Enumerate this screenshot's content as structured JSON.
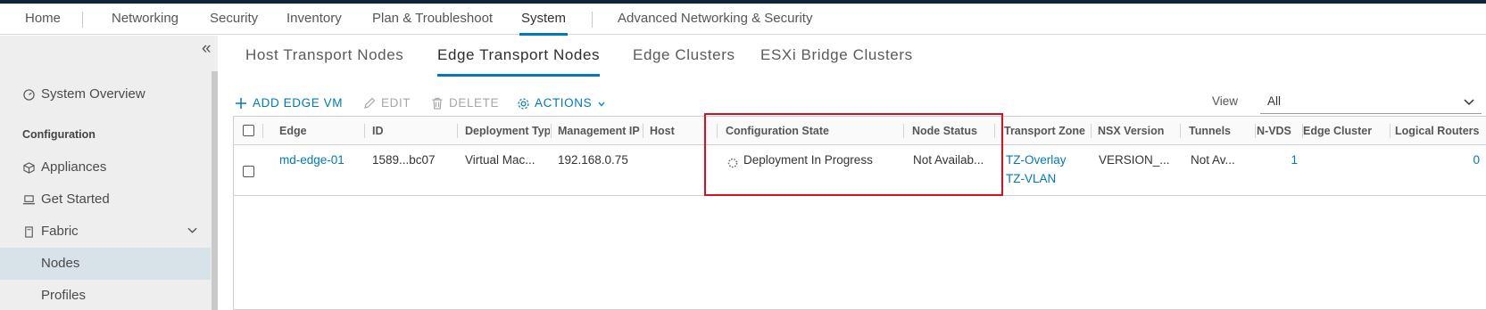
{
  "nav": {
    "home": "Home",
    "networking": "Networking",
    "security": "Security",
    "inventory": "Inventory",
    "plan": "Plan & Troubleshoot",
    "system": "System",
    "advanced": "Advanced Networking & Security"
  },
  "sidebar": {
    "collapse_glyph": "«",
    "system_overview": "System Overview",
    "configuration_header": "Configuration",
    "appliances": "Appliances",
    "get_started": "Get Started",
    "fabric": "Fabric",
    "nodes": "Nodes",
    "profiles": "Profiles"
  },
  "subtabs": {
    "host": "Host Transport Nodes",
    "edge": "Edge Transport Nodes",
    "clusters": "Edge Clusters",
    "esxi": "ESXi Bridge Clusters"
  },
  "toolbar": {
    "add": "ADD EDGE VM",
    "edit": "EDIT",
    "delete": "DELETE",
    "actions": "ACTIONS",
    "view_label": "View",
    "view_value": "All"
  },
  "grid": {
    "headers": {
      "edge": "Edge",
      "id": "ID",
      "deployment": "Deployment Typ",
      "mgmt_ip": "Management IP",
      "host": "Host",
      "config_state": "Configuration State",
      "node_status": "Node Status",
      "tz": "Transport Zone",
      "nsx_version": "NSX Version",
      "tunnels": "Tunnels",
      "nvds": "N-VDS",
      "edge_cluster": "Edge Cluster",
      "logical_routers": "Logical Routers"
    },
    "rows": [
      {
        "edge": "md-edge-01",
        "id": "1589...bc07",
        "deployment": "Virtual Mac...",
        "mgmt_ip": "192.168.0.75",
        "host": "",
        "config_state": "Deployment In Progress",
        "node_status": "Not Availab...",
        "tz1": "TZ-Overlay",
        "tz2": "TZ-VLAN",
        "nsx_version": "VERSION_...",
        "tunnels": "Not Av...",
        "nvds": "1",
        "edge_cluster": "",
        "logical_routers": "0"
      }
    ]
  },
  "colors": {
    "accent": "#0079b8",
    "highlight": "#d90f1f",
    "topbar": "#0f2537"
  }
}
